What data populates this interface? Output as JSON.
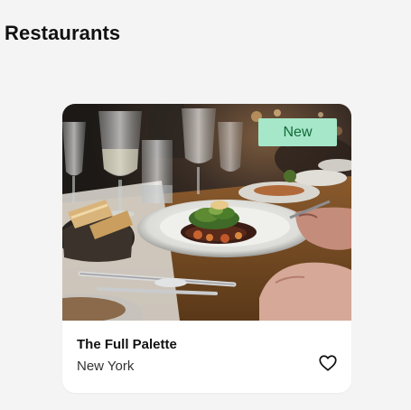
{
  "page": {
    "title": "Restaurants"
  },
  "restaurant_card": {
    "badge": "New",
    "name": "The Full Palette",
    "location": "New York",
    "photo_icon": "restaurant-dinner-photo",
    "favorite_icon": "heart-outline-icon"
  },
  "colors": {
    "background": "#f4f4f4",
    "card": "#ffffff",
    "badge_bg": "#a6e6c9",
    "badge_text": "#126b37"
  }
}
